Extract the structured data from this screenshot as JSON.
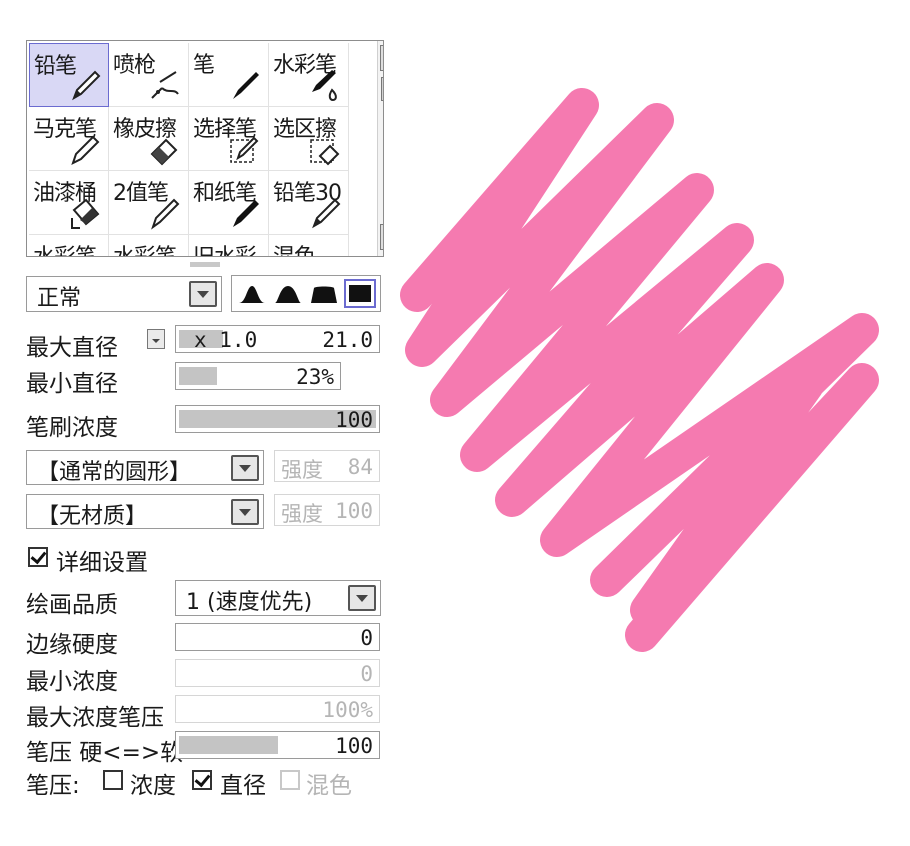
{
  "tools": [
    {
      "label": "铅笔",
      "icon": "pencil-icon",
      "selected": true
    },
    {
      "label": "喷枪",
      "icon": "airbrush-icon"
    },
    {
      "label": "笔",
      "icon": "pen-icon"
    },
    {
      "label": "水彩笔",
      "icon": "watercolor-brush-icon"
    },
    {
      "label": "马克笔",
      "icon": "marker-icon"
    },
    {
      "label": "橡皮擦",
      "icon": "eraser-icon"
    },
    {
      "label": "选择笔",
      "icon": "selection-pen-icon"
    },
    {
      "label": "选区擦",
      "icon": "selection-eraser-icon"
    },
    {
      "label": "油漆桶",
      "icon": "paint-bucket-icon"
    },
    {
      "label": "2值笔",
      "icon": "binary-pen-icon"
    },
    {
      "label": "和纸笔",
      "icon": "washi-pen-icon"
    },
    {
      "label": "铅笔30",
      "icon": "pencil-icon"
    },
    {
      "label": "水彩笔",
      "icon": ""
    },
    {
      "label": "水彩笔",
      "icon": ""
    },
    {
      "label": "旧水彩",
      "icon": ""
    },
    {
      "label": "混色",
      "icon": ""
    }
  ],
  "blend_mode": {
    "value": "正常"
  },
  "brush_shapes": [
    "soft-shape-icon",
    "medium-shape-icon",
    "hard-shape-icon",
    "square-shape-icon"
  ],
  "max_size": {
    "label": "最大直径",
    "multiplier": "x 1.0",
    "value": "21.0"
  },
  "min_size": {
    "label": "最小直径",
    "value": "23%",
    "fraction": 0.23
  },
  "density": {
    "label": "笔刷浓度",
    "value": "100",
    "fraction": 1.0
  },
  "brush_shape": {
    "value": "【通常的圆形】",
    "strength_label": "强度",
    "strength_value": "84"
  },
  "texture": {
    "value": "【无材质】",
    "strength_label": "强度",
    "strength_value": "100"
  },
  "advanced": {
    "label": "详细设置",
    "checked": true
  },
  "quality": {
    "label": "绘画品质",
    "value": "1 (速度优先)"
  },
  "edge_hardness": {
    "label": "边缘硬度",
    "value": "0"
  },
  "min_density": {
    "label": "最小浓度",
    "value": "0"
  },
  "max_density_pressure": {
    "label": "最大浓度笔压",
    "value": "100%"
  },
  "pressure_curve": {
    "label": "笔压 硬<=>软",
    "value": "100",
    "fraction": 0.5
  },
  "pressure": {
    "label": "笔压:",
    "density": {
      "label": "浓度",
      "checked": false
    },
    "size": {
      "label": "直径",
      "checked": true
    },
    "blend": {
      "label": "混色",
      "checked": false
    }
  },
  "colors": {
    "stroke": "#f57ab0",
    "selected_bg": "#d9d8f5"
  }
}
